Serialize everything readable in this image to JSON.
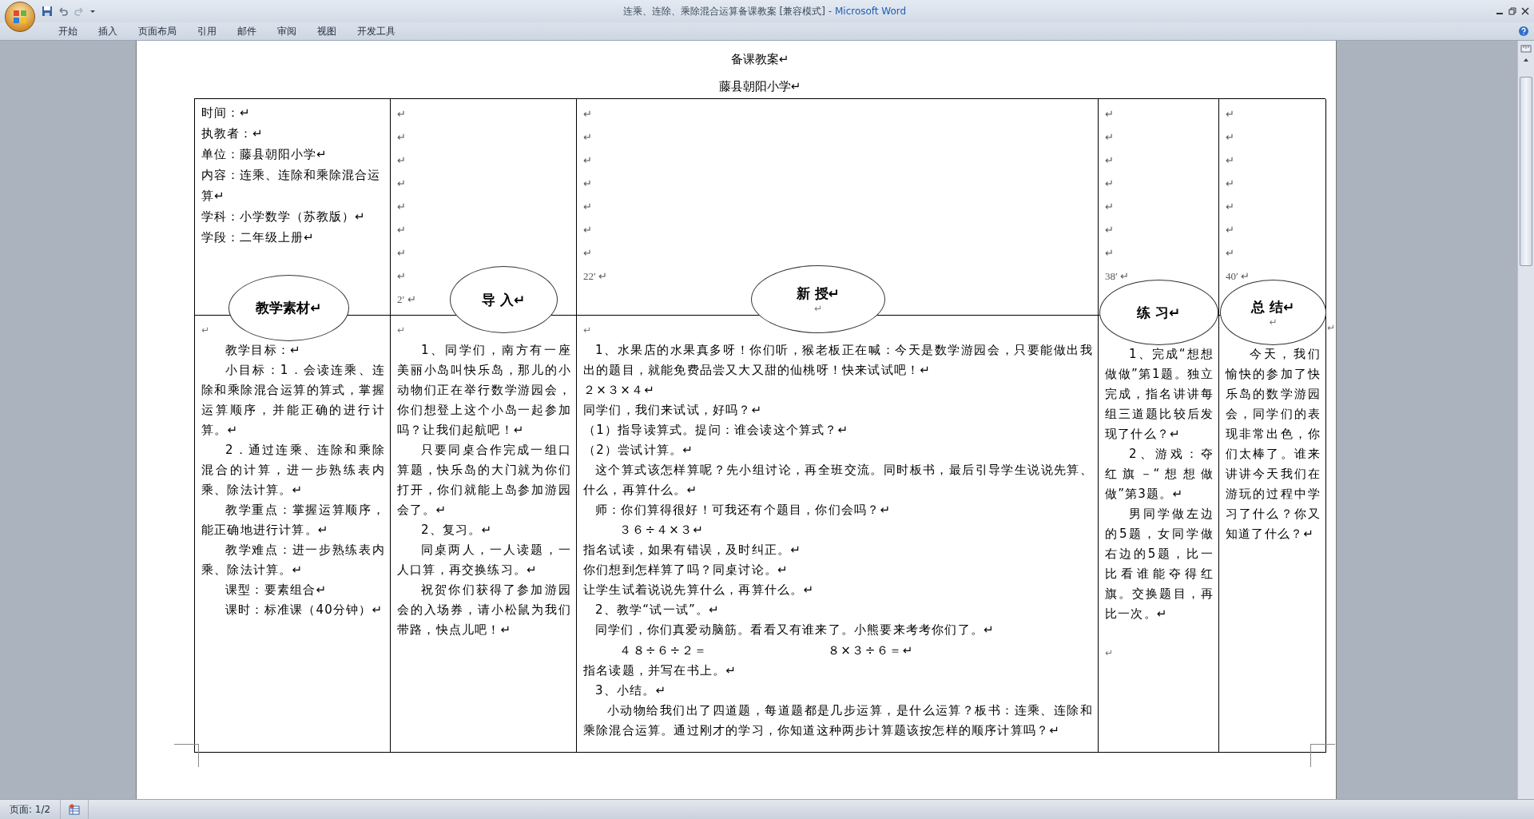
{
  "window": {
    "title": "连乘、连除、乘除混合运算备课教案 [兼容模式]",
    "app": "- Microsoft Word"
  },
  "ribbon_tabs": [
    "开始",
    "插入",
    "页面布局",
    "引用",
    "邮件",
    "审阅",
    "视图",
    "开发工具"
  ],
  "document": {
    "heading": "备课教案↵",
    "school": "藤县朝阳小学↵",
    "top_cells": [
      {
        "lines": [
          "时间：↵",
          "执教者：↵",
          "单位：藤县朝阳小学↵",
          "内容：连乘、连除和乘除混合运算↵",
          "学科：小学数学（苏教版）↵",
          "学段：二年级上册↵"
        ],
        "kind": "info"
      },
      {
        "lines": [
          "↵",
          "↵",
          "↵",
          "↵",
          "↵",
          "↵",
          "↵",
          "↵",
          "2′ ↵"
        ],
        "kind": "marks"
      },
      {
        "lines": [
          "↵",
          "↵",
          "↵",
          "↵",
          "↵",
          "↵",
          "↵",
          "22′ ↵"
        ],
        "kind": "marks"
      },
      {
        "lines": [
          "↵",
          "↵",
          "↵",
          "↵",
          "↵",
          "↵",
          "↵",
          "38′ ↵"
        ],
        "kind": "marks"
      },
      {
        "lines": [
          "↵",
          "↵",
          "↵",
          "↵",
          "↵",
          "↵",
          "↵",
          "40′ ↵"
        ],
        "kind": "marks"
      }
    ],
    "ovals": [
      {
        "label": "教学素材↵"
      },
      {
        "label": "导 入↵"
      },
      {
        "label": "新 授↵",
        "note": "↵"
      },
      {
        "label": "练 习↵"
      },
      {
        "label": "总 结↵",
        "note": "↵"
      }
    ],
    "bottom_cells": [
      {
        "paragraphs": [
          {
            "kind": "mark",
            "text": "↵"
          },
          {
            "kind": "indented",
            "text": "教学目标：↵"
          },
          {
            "kind": "indented",
            "text": "小目标：1．会读连乘、连除和乘除混合运算的算式，掌握运算顺序，并能正确的进行计算。↵"
          },
          {
            "kind": "indented",
            "text": "2．通过连乘、连除和乘除混合的计算，进一步熟练表内乘、除法计算。↵"
          },
          {
            "kind": "indented",
            "text": "教学重点：掌握运算顺序，能正确地进行计算。↵"
          },
          {
            "kind": "indented",
            "text": "教学难点：进一步熟练表内乘、除法计算。↵"
          },
          {
            "kind": "indented",
            "text": "课型：要素组合↵"
          },
          {
            "kind": "indented",
            "text": "课时：标准课（40分钟）↵"
          }
        ]
      },
      {
        "paragraphs": [
          {
            "kind": "mark",
            "text": "↵"
          },
          {
            "kind": "indented",
            "text": "1、同学们，南方有一座美丽小岛叫快乐岛，那儿的小动物们正在举行数学游园会，你们想登上这个小岛一起参加吗？让我们起航吧！↵"
          },
          {
            "kind": "indented",
            "text": "只要同桌合作完成一组口算题，快乐岛的大门就为你们打开，你们就能上岛参加游园会了。↵"
          },
          {
            "kind": "indented",
            "text": "2、复习。↵"
          },
          {
            "kind": "indented",
            "text": "同桌两人，一人读题，一人口算，再交换练习。↵"
          },
          {
            "kind": "indented",
            "text": "祝贺你们获得了参加游园会的入场券，请小松鼠为我们带路，快点儿吧！↵"
          }
        ]
      },
      {
        "paragraphs": [
          {
            "kind": "mark",
            "text": "↵"
          },
          {
            "kind": "half",
            "text": "1、水果店的水果真多呀！你们听，猴老板正在喊：今天是数学游园会，只要能做出我出的题目，就能免费品尝又大又甜的仙桃呀！快来试试吧！↵"
          },
          {
            "kind": "plain",
            "text": "２×３×４↵"
          },
          {
            "kind": "plain",
            "text": "同学们，我们来试试，好吗？↵"
          },
          {
            "kind": "plain",
            "text": "（1）指导读算式。提问：谁会读这个算式？↵"
          },
          {
            "kind": "plain",
            "text": "（2）尝试计算。↵"
          },
          {
            "kind": "half",
            "text": "这个算式该怎样算呢？先小组讨论，再全班交流。同时板书，最后引导学生说说先算、什么，再算什么。↵"
          },
          {
            "kind": "half",
            "text": "师：你们算得很好！可我还有个题目，你们会吗？↵"
          },
          {
            "kind": "formula",
            "text": "３６÷４×３↵"
          },
          {
            "kind": "plain",
            "text": "指名试读，如果有错误，及时纠正。↵"
          },
          {
            "kind": "plain",
            "text": "你们想到怎样算了吗？同桌讨论。↵"
          },
          {
            "kind": "plain",
            "text": "让学生试着说说先算什么，再算什么。↵"
          },
          {
            "kind": "half",
            "text": "2、教学“试一试”。↵"
          },
          {
            "kind": "half",
            "text": "同学们，你们真爱动脑筋。看看又有谁来了。小熊要来考考你们了。↵"
          },
          {
            "kind": "formulas",
            "items": [
              "４８÷６÷２＝",
              "８×３÷６＝↵"
            ]
          },
          {
            "kind": "plain",
            "text": "指名读题，并写在书上。↵"
          },
          {
            "kind": "half",
            "text": "3、小结。↵"
          },
          {
            "kind": "indented",
            "text": "小动物给我们出了四道题，每道题都是几步运算，是什么运算？板书：连乘、连除和乘除混合运算。通过刚才的学习，你知道这种两步计算题该按怎样的顺序计算吗？↵"
          }
        ]
      },
      {
        "paragraphs": [
          {
            "kind": "indented",
            "text": "1、完成“想想做做”第1题。独立完成，指名讲讲每组三道题比较后发现了什么？↵"
          },
          {
            "kind": "indented",
            "text": "2、游戏：夺红旗－“想想做做”第3题。↵"
          },
          {
            "kind": "indented",
            "text": "男同学做左边的5题，女同学做右边的5题，比一比看谁能夺得红旗。交换题目，再比一次。↵"
          },
          {
            "kind": "trailing",
            "text": "↵"
          }
        ]
      },
      {
        "paragraphs": [
          {
            "kind": "indented",
            "text": "今天，我们愉快的参加了快乐岛的数学游园会，同学们的表现非常出色，你们太棒了。谁来讲讲今天我们在游玩的过程中学习了什么？你又知道了什么？↵"
          }
        ]
      }
    ],
    "row_end_mark": "↵"
  },
  "status_bar": {
    "page": "页面: 1/2"
  }
}
